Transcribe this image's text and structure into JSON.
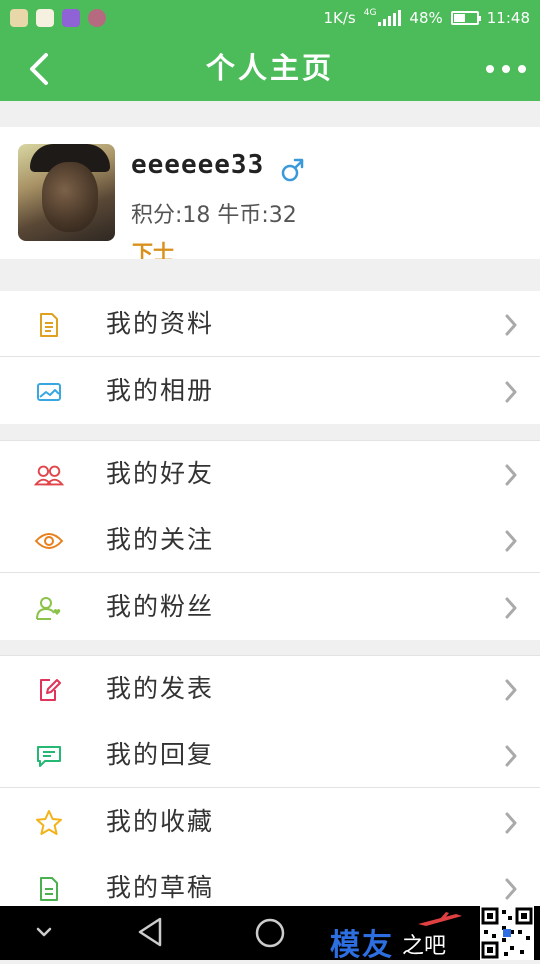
{
  "status_bar": {
    "net_speed": "1K/s",
    "network_type": "4G",
    "battery_text": "48%",
    "battery_level": 0.48,
    "time": "11:48"
  },
  "app_bar": {
    "title": "个人主页",
    "back_icon": "chevron-left-icon",
    "more_icon": "more-dots-icon"
  },
  "profile": {
    "username": "eeeeee33",
    "gender_symbol": "♂",
    "points_text": "积分:18 牛币:32",
    "rank_text": "下士"
  },
  "menu_groups": [
    {
      "items": [
        {
          "label": "我的资料",
          "icon": "document-icon",
          "color": "#e0a020"
        },
        {
          "label": "我的相册",
          "icon": "image-icon",
          "color": "#3aa7e0"
        }
      ]
    },
    {
      "items": [
        {
          "label": "我的好友",
          "icon": "friends-icon",
          "color": "#e0454a"
        },
        {
          "label": "我的关注",
          "icon": "eye-icon",
          "color": "#e8801e"
        },
        {
          "label": "我的粉丝",
          "icon": "user-heart-icon",
          "color": "#8bc34a"
        }
      ]
    },
    {
      "items": [
        {
          "label": "我的发表",
          "icon": "edit-icon",
          "color": "#e0355a"
        },
        {
          "label": "我的回复",
          "icon": "comment-icon",
          "color": "#25b873"
        },
        {
          "label": "我的收藏",
          "icon": "star-icon",
          "color": "#f2b31b"
        },
        {
          "label": "我的草稿",
          "icon": "draft-icon",
          "color": "#4caf50"
        }
      ]
    }
  ],
  "watermark": {
    "brand": "模友",
    "suffix": "之吧"
  },
  "colors": {
    "primary_green": "#4cbc5a",
    "background": "#f0f0f0",
    "rank_orange": "#d9911c",
    "gender_blue": "#3a9ad9"
  }
}
